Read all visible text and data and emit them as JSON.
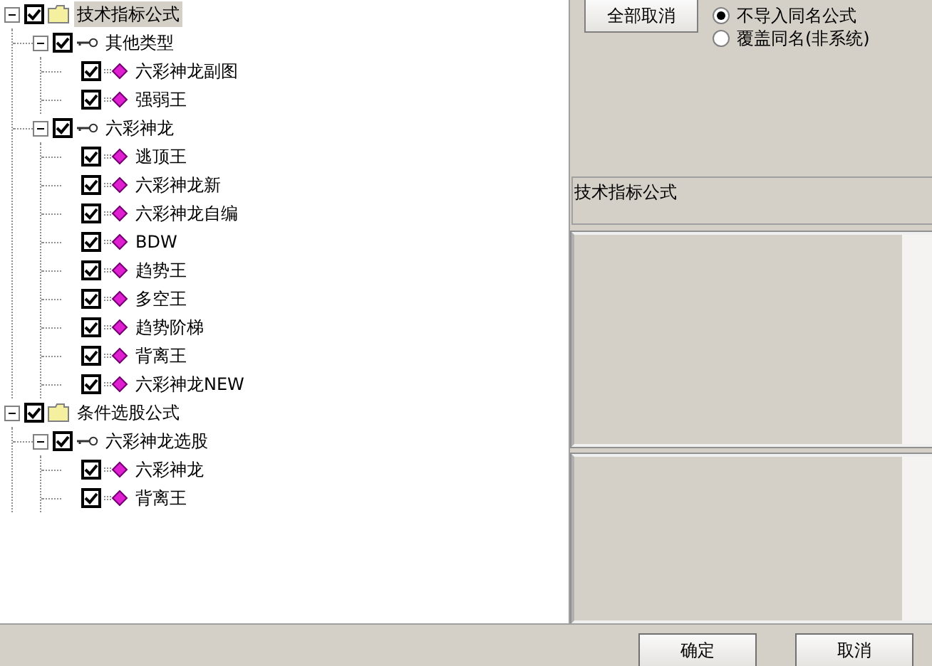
{
  "tree": [
    {
      "label": "技术指标公式",
      "kind": "folder",
      "checked": true,
      "expanded": true,
      "selected": true,
      "children": [
        {
          "label": "其他类型",
          "kind": "group",
          "checked": true,
          "expanded": true,
          "selected": false,
          "children": [
            {
              "label": "六彩神龙副图",
              "kind": "formula",
              "checked": true,
              "selected": false
            },
            {
              "label": "强弱王",
              "kind": "formula",
              "checked": true,
              "selected": false
            }
          ]
        },
        {
          "label": "六彩神龙",
          "kind": "group",
          "checked": true,
          "expanded": true,
          "selected": false,
          "children": [
            {
              "label": "逃顶王",
              "kind": "formula",
              "checked": true,
              "selected": false
            },
            {
              "label": "六彩神龙新",
              "kind": "formula",
              "checked": true,
              "selected": false
            },
            {
              "label": "六彩神龙自编",
              "kind": "formula",
              "checked": true,
              "selected": false
            },
            {
              "label": "BDW",
              "kind": "formula",
              "checked": true,
              "selected": false
            },
            {
              "label": "趋势王",
              "kind": "formula",
              "checked": true,
              "selected": false
            },
            {
              "label": "多空王",
              "kind": "formula",
              "checked": true,
              "selected": false
            },
            {
              "label": "趋势阶梯",
              "kind": "formula",
              "checked": true,
              "selected": false
            },
            {
              "label": "背离王",
              "kind": "formula",
              "checked": true,
              "selected": false
            },
            {
              "label": "六彩神龙NEW",
              "kind": "formula",
              "checked": true,
              "selected": false
            }
          ]
        }
      ]
    },
    {
      "label": "条件选股公式",
      "kind": "folder",
      "checked": true,
      "expanded": true,
      "selected": false,
      "children": [
        {
          "label": "六彩神龙选股",
          "kind": "group",
          "checked": true,
          "expanded": true,
          "selected": false,
          "children": [
            {
              "label": "六彩神龙",
              "kind": "formula",
              "checked": true,
              "selected": false
            },
            {
              "label": "背离王",
              "kind": "formula",
              "checked": true,
              "selected": false
            }
          ]
        }
      ]
    }
  ],
  "deselect_all_button": "全部取消",
  "import_options": [
    {
      "label": "不导入同名公式",
      "selected": true
    },
    {
      "label": "覆盖同名(非系统)",
      "selected": false
    }
  ],
  "info_box": "技术指标公式",
  "buttons": [
    "确定",
    "取消"
  ]
}
